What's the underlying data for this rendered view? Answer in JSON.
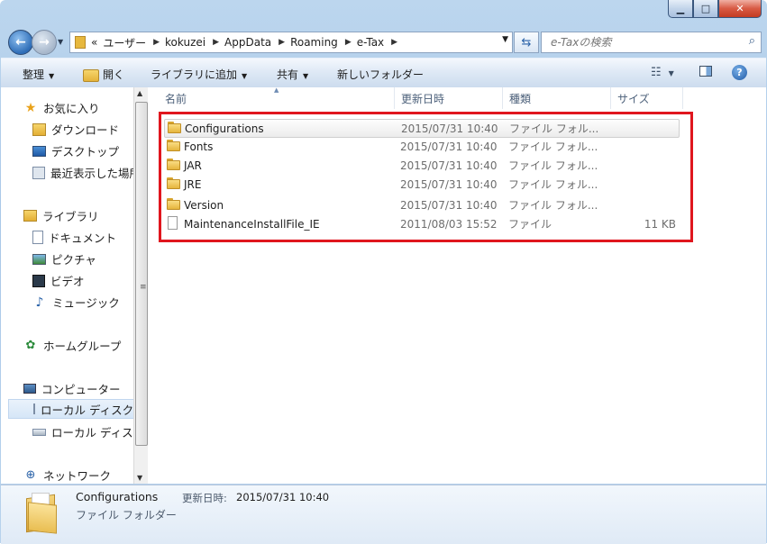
{
  "nav": {
    "recent_pages": "«",
    "path": [
      "ユーザー",
      "kokuzei",
      "AppData",
      "Roaming",
      "e-Tax"
    ],
    "search_placeholder": "e-Taxの検索"
  },
  "toolbar": {
    "organize": "整理",
    "open": "開く",
    "include_library": "ライブラリに追加",
    "share": "共有",
    "new_folder": "新しいフォルダー"
  },
  "sidebar": {
    "favorites": "お気に入り",
    "downloads": "ダウンロード",
    "desktop": "デスクトップ",
    "recent": "最近表示した場所",
    "libraries": "ライブラリ",
    "documents": "ドキュメント",
    "pictures": "ピクチャ",
    "videos": "ビデオ",
    "music": "ミュージック",
    "homegroup": "ホームグループ",
    "computer": "コンピューター",
    "local_disk_1": "ローカル ディスク",
    "local_disk_2": "ローカル ディスク",
    "network": "ネットワーク"
  },
  "columns": {
    "name": "名前",
    "date": "更新日時",
    "type": "種類",
    "size": "サイズ"
  },
  "files": [
    {
      "name": "Configurations",
      "date": "2015/07/31 10:40",
      "type": "ファイル フォル...",
      "size": "",
      "icon": "folder-icon"
    },
    {
      "name": "Fonts",
      "date": "2015/07/31 10:40",
      "type": "ファイル フォル...",
      "size": "",
      "icon": "folder-icon"
    },
    {
      "name": "JAR",
      "date": "2015/07/31 10:40",
      "type": "ファイル フォル...",
      "size": "",
      "icon": "folder-icon"
    },
    {
      "name": "JRE",
      "date": "2015/07/31 10:40",
      "type": "ファイル フォル...",
      "size": "",
      "icon": "folder-icon"
    },
    {
      "name": "Version",
      "date": "2015/07/31 10:40",
      "type": "ファイル フォル...",
      "size": "",
      "icon": "folder-icon"
    },
    {
      "name": "MaintenanceInstallFile_IE",
      "date": "2011/08/03 15:52",
      "type": "ファイル",
      "size": "11 KB",
      "icon": "file-icon"
    }
  ],
  "details": {
    "name": "Configurations",
    "date_label": "更新日時:",
    "date": "2015/07/31 10:40",
    "type": "ファイル フォルダー"
  },
  "colors": {
    "highlight": "#e0161e",
    "folder": "#f0c550"
  }
}
